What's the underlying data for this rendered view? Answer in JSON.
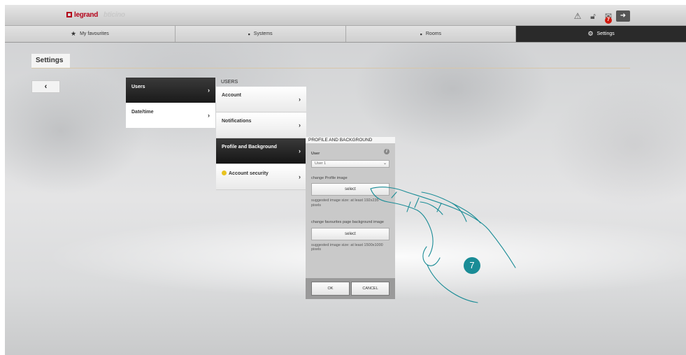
{
  "brand": {
    "logo_primary": "legrand",
    "logo_secondary": "bticino",
    "primary_color": "#b30018"
  },
  "topbar": {
    "icons": [
      "warning-icon",
      "lock-icon",
      "mail-icon",
      "exit-icon"
    ],
    "mail_badge_count": "7"
  },
  "tabs": [
    {
      "label": "My favourites",
      "icon": "star-icon"
    },
    {
      "label": "Systems",
      "icon": "cube-icon"
    },
    {
      "label": "Rooms",
      "icon": "room-icon"
    },
    {
      "label": "Settings",
      "icon": "gear-icon",
      "active": true
    }
  ],
  "page": {
    "title": "Settings",
    "back": "‹"
  },
  "menu1": {
    "items": [
      {
        "label": "Users",
        "active": true
      },
      {
        "label": "Date/time"
      }
    ]
  },
  "menu2": {
    "header": "USERS",
    "items": [
      {
        "label": "Account"
      },
      {
        "label": "Notifications"
      },
      {
        "label": "Profile and Background",
        "active": true
      },
      {
        "label": "Account security"
      }
    ]
  },
  "panel": {
    "header": "PROFILE AND BACKGROUND",
    "user_label": "User",
    "user_value": "User 1",
    "profile_label": "change Profile image",
    "select_label": "select",
    "profile_hint": "suggested image size: at least 192x235 pixels",
    "bg_label": "change favourites page background image",
    "bg_select_label": "select",
    "bg_hint": "suggested image size: at least 1500x1000 pixels",
    "ok": "OK",
    "cancel": "CANCEL"
  },
  "callout": {
    "step": "7",
    "color": "#1a8c96"
  }
}
